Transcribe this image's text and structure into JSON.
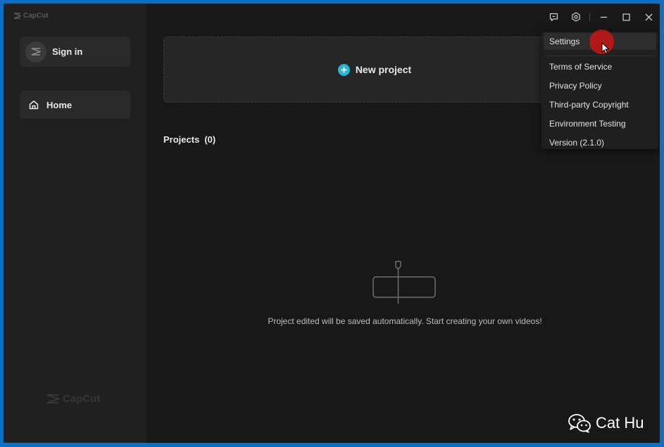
{
  "app": {
    "logo_text": "CapCut"
  },
  "sidebar": {
    "signin_label": "Sign in",
    "home_label": "Home",
    "watermark_text": "CapCut"
  },
  "main": {
    "new_project_label": "New project",
    "projects_label": "Projects",
    "projects_count": "(0)",
    "empty_message": "Project edited will be saved automatically. Start creating your own videos!"
  },
  "menu": {
    "items": [
      {
        "label": "Settings",
        "active": true
      },
      {
        "label": "Terms of Service"
      },
      {
        "label": "Privacy Policy"
      },
      {
        "label": "Third-party Copyright"
      },
      {
        "label": "Environment Testing"
      },
      {
        "label": "Version (2.1.0)"
      }
    ]
  },
  "title_bar": {
    "icons": [
      "feedback-icon",
      "settings-icon",
      "minimize-icon",
      "maximize-icon",
      "close-icon"
    ]
  },
  "overlay": {
    "watermark_label": "Cat Hu"
  },
  "colors": {
    "background": "#181818",
    "sidebar": "#202020",
    "accent": "#23b8d0",
    "click_marker": "#c81616",
    "desktop": "#0c6fc4"
  }
}
